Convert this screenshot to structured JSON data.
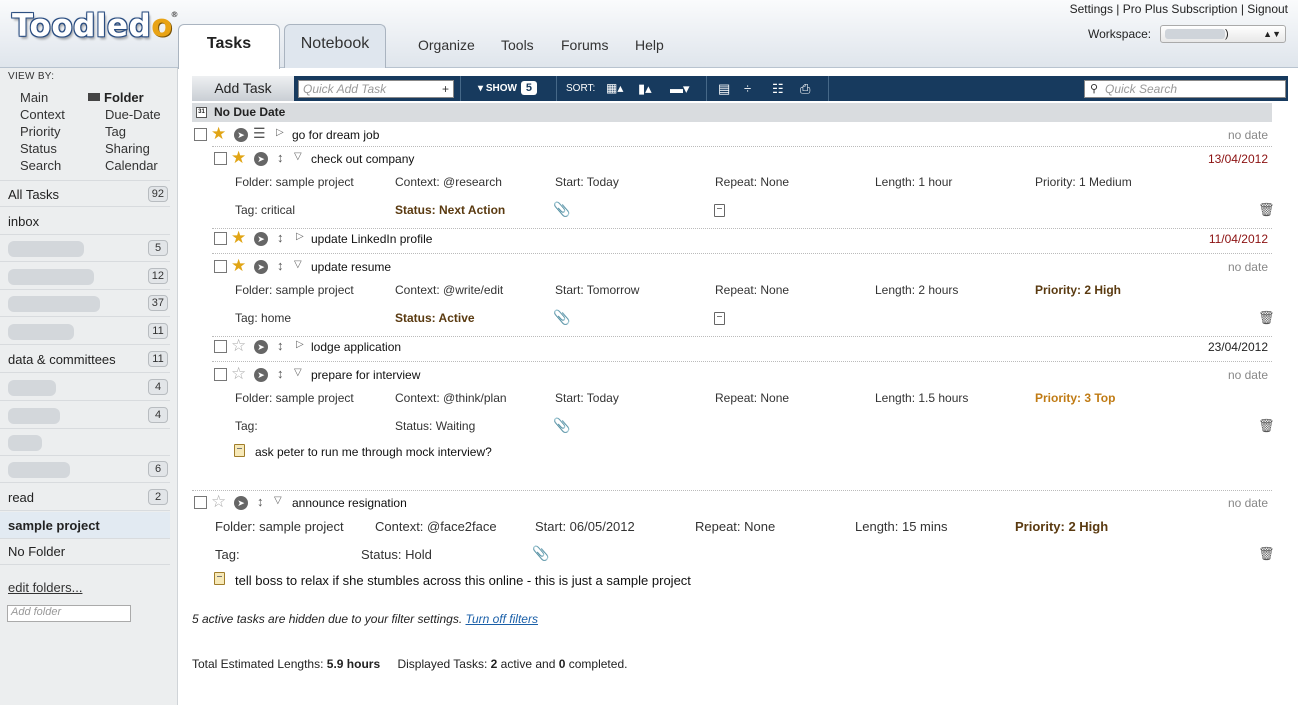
{
  "logo": {
    "text": "Toodledo",
    "mark": "®"
  },
  "tabs": [
    {
      "label": "Tasks"
    },
    {
      "label": "Notebook"
    }
  ],
  "nav": [
    {
      "label": "Organize"
    },
    {
      "label": "Tools"
    },
    {
      "label": "Forums"
    },
    {
      "label": "Help"
    }
  ],
  "top_links": {
    "settings": "Settings",
    "subscription": "Pro Plus Subscription",
    "signout": "Signout",
    "sep": "|"
  },
  "workspace": {
    "label": "Workspace:",
    "value": ")"
  },
  "sidebar": {
    "view_by_label": "VIEW BY:",
    "views": [
      "Main",
      "Folder",
      "Context",
      "Due-Date",
      "Priority",
      "Tag",
      "Status",
      "Sharing",
      "Search",
      "Calendar"
    ],
    "selected_view": "Folder",
    "folders": [
      {
        "name": "All Tasks",
        "count": "92"
      },
      {
        "name": "inbox",
        "count": ""
      },
      {
        "name": "",
        "count": "5"
      },
      {
        "name": "",
        "count": "12"
      },
      {
        "name": "",
        "count": "37"
      },
      {
        "name": "",
        "count": "11"
      },
      {
        "name": "data & committees",
        "count": "11"
      },
      {
        "name": "",
        "count": "4"
      },
      {
        "name": "",
        "count": "4"
      },
      {
        "name": "",
        "count": ""
      },
      {
        "name": "",
        "count": "6"
      },
      {
        "name": "read",
        "count": "2"
      },
      {
        "name": "sample project",
        "count": ""
      },
      {
        "name": "No Folder",
        "count": ""
      }
    ],
    "edit_folders": "edit folders...",
    "add_folder_placeholder": "Add folder"
  },
  "toolbar": {
    "add_task": "Add Task",
    "quick_add_placeholder": "Quick Add Task",
    "quick_add_plus": "+",
    "show_label": "SHOW",
    "show_count": "5",
    "sort_label": "SORT:",
    "quick_search_placeholder": "Quick Search"
  },
  "group": {
    "label": "No Due Date"
  },
  "labels": {
    "folder": "Folder:",
    "context": "Context:",
    "start": "Start:",
    "repeat": "Repeat:",
    "length": "Length:",
    "priority": "Priority:",
    "tag": "Tag:",
    "status": "Status:"
  },
  "tasks": [
    {
      "title": "go for dream job",
      "date": "no date",
      "starred": true
    },
    {
      "title": "check out company",
      "date": "13/04/2012",
      "starred": true,
      "folder": "Folder: sample project",
      "context": "Context: @research",
      "start": "Start: Today",
      "repeat": "Repeat: None",
      "length": "Length: 1 hour",
      "priority": "Priority: 1 Medium",
      "tag": "Tag: critical",
      "status": "Status: Next Action"
    },
    {
      "title": "update LinkedIn profile",
      "date": "11/04/2012",
      "starred": true
    },
    {
      "title": "update resume",
      "date": "no date",
      "starred": true,
      "folder": "Folder: sample project",
      "context": "Context: @write/edit",
      "start": "Start: Tomorrow",
      "repeat": "Repeat: None",
      "length": "Length: 2 hours",
      "priority": "Priority: 2 High",
      "tag": "Tag: home",
      "status": "Status: Active"
    },
    {
      "title": "lodge application",
      "date": "23/04/2012",
      "starred": false
    },
    {
      "title": "prepare for interview",
      "date": "no date",
      "starred": false,
      "folder": "Folder: sample project",
      "context": "Context: @think/plan",
      "start": "Start: Today",
      "repeat": "Repeat: None",
      "length": "Length: 1.5 hours",
      "priority": "Priority: 3 Top",
      "tag": "Tag:",
      "status": "Status: Waiting",
      "note": "ask peter to run me through mock interview?"
    },
    {
      "title": "announce resignation",
      "date": "no date",
      "starred": false,
      "folder": "Folder: sample project",
      "context": "Context: @face2face",
      "start": "Start: 06/05/2012",
      "repeat": "Repeat: None",
      "length": "Length: 15 mins",
      "priority": "Priority: 2 High",
      "tag": "Tag:",
      "status": "Status: Hold",
      "note": "tell boss to relax if she stumbles across this online - this is just a sample project"
    }
  ],
  "filter_message": {
    "text": "5 active tasks are hidden due to your filter settings.",
    "link": "Turn off filters"
  },
  "totals": {
    "lengths_label": "Total Estimated Lengths:",
    "lengths_value": "5.9 hours",
    "displayed_label": "Displayed Tasks:",
    "active": "2",
    "active_label": "active and",
    "completed": "0",
    "completed_label": "completed."
  }
}
